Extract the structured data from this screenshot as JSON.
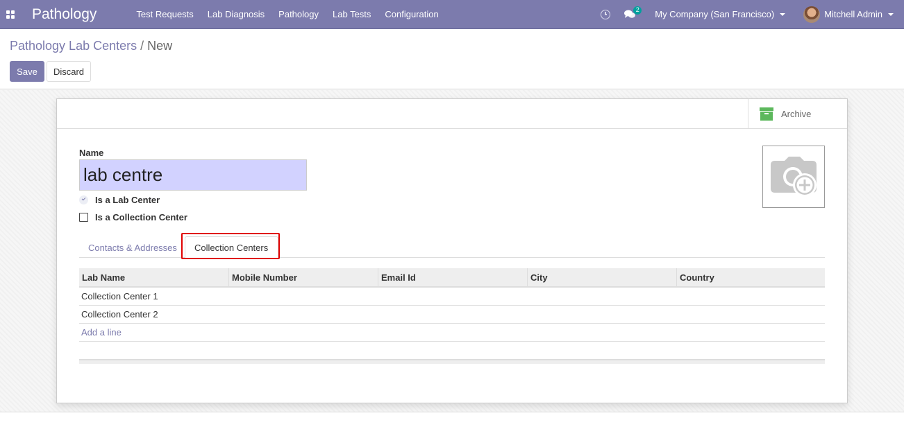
{
  "navbar": {
    "brand": "Pathology",
    "menu": [
      "Test Requests",
      "Lab Diagnosis",
      "Pathology",
      "Lab Tests",
      "Configuration"
    ],
    "chat_badge": "2",
    "company": "My Company (San Francisco)",
    "user": "Mitchell Admin",
    "color": "#7c7bad"
  },
  "breadcrumb": {
    "parent": "Pathology Lab Centers",
    "separator": "/",
    "current": "New"
  },
  "actions": {
    "save": "Save",
    "discard": "Discard"
  },
  "button_box": {
    "archive": "Archive"
  },
  "form": {
    "name_label": "Name",
    "name_value": "lab centre",
    "is_lab_center": {
      "label": "Is a Lab Center",
      "checked": true
    },
    "is_collection_center": {
      "label": "Is a Collection Center",
      "checked": false
    }
  },
  "tabs": [
    {
      "label": "Contacts & Addresses",
      "active": false
    },
    {
      "label": "Collection Centers",
      "active": true
    }
  ],
  "table": {
    "columns": [
      "Lab Name",
      "Mobile Number",
      "Email Id",
      "City",
      "Country"
    ],
    "rows": [
      [
        "Collection Center 1",
        "",
        "",
        "",
        ""
      ],
      [
        "Collection Center 2",
        "",
        "",
        "",
        ""
      ]
    ],
    "add_line": "Add a line"
  },
  "icons": [
    "apps-icon",
    "clock-icon",
    "chat-icon",
    "archive-icon",
    "camera-add-icon"
  ]
}
